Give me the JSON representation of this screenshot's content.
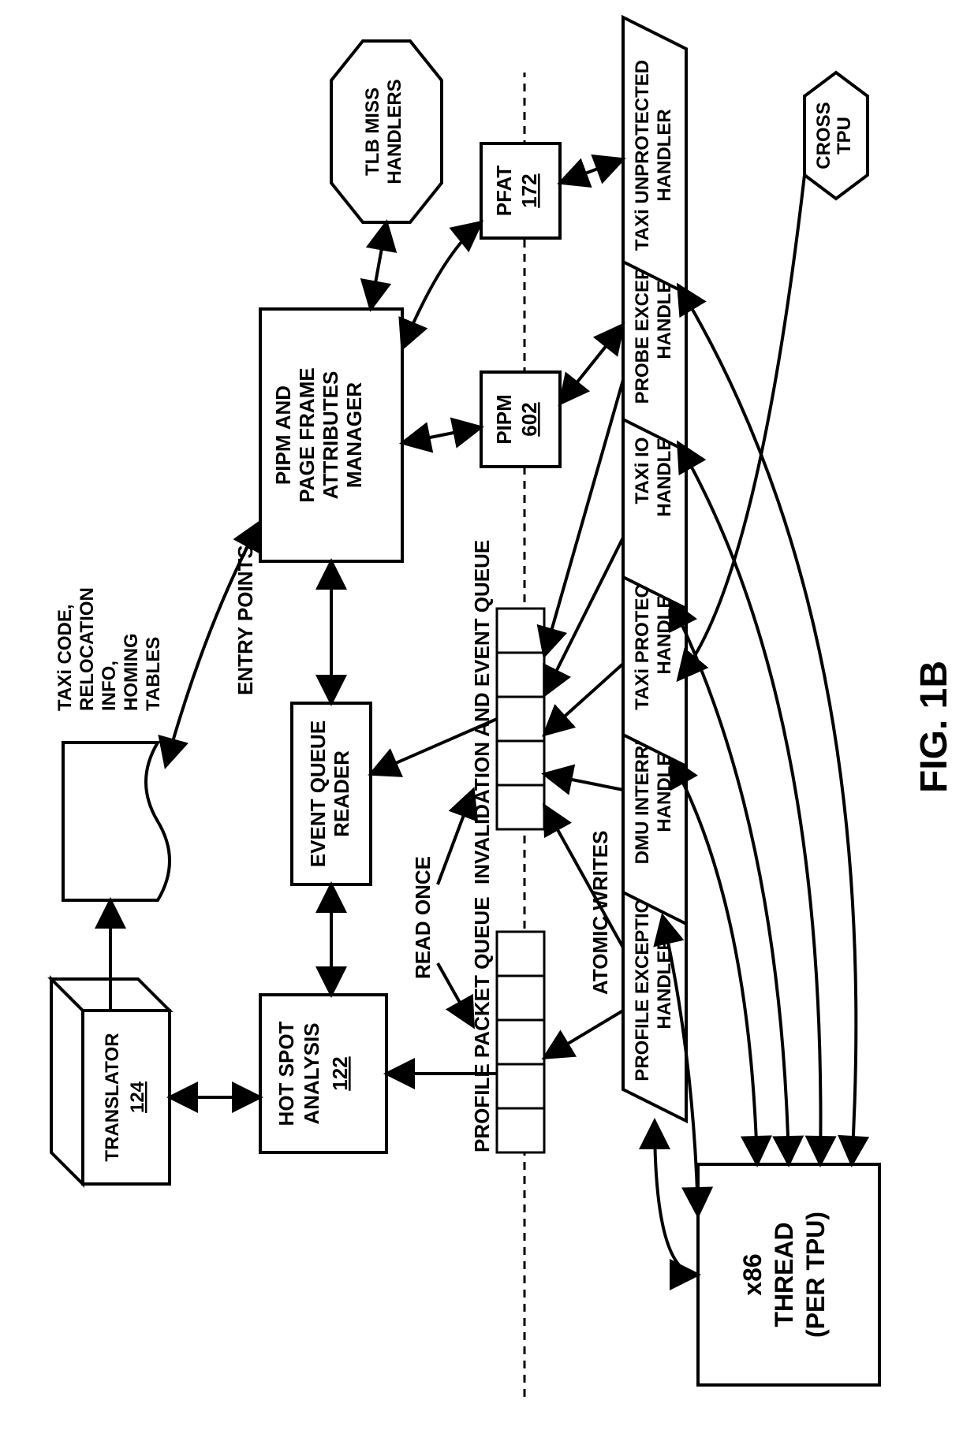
{
  "figure_label": "FIG. 1B",
  "blocks": {
    "x86_thread": {
      "line1": "x86",
      "line2": "THREAD",
      "line3": "(PER TPU)"
    },
    "cross_tpu": {
      "line1": "CROSS",
      "line2": "TPU"
    },
    "profile_exc": {
      "line1": "PROFILE EXCEPTION",
      "line2": "HANDLER"
    },
    "dmu_int": {
      "line1": "DMU INTERRUPT",
      "line2": "HANDLER"
    },
    "taxi_prot": {
      "line1": "TAXi PROTECTED",
      "line2": "HANDLER"
    },
    "taxi_io": {
      "line1": "TAXi IO",
      "line2": "HANDLER"
    },
    "probe_exc": {
      "line1": "PROBE EXCEPTION",
      "line2": "HANDLER"
    },
    "taxi_unprot": {
      "line1": "TAXi UNPROTECTED",
      "line2": "HANDLER"
    },
    "hot_spot": {
      "line1": "HOT SPOT",
      "line2": "ANALYSIS",
      "ref": "122"
    },
    "translator": {
      "line1": "TRANSLATOR",
      "ref": "124"
    },
    "event_reader": {
      "line1": "EVENT QUEUE",
      "line2": "READER"
    },
    "pipm_mgr": {
      "line1": "PIPM AND",
      "line2": "PAGE FRAME",
      "line3": "ATTRIBUTES",
      "line4": "MANAGER"
    },
    "pipm": {
      "line1": "PIPM",
      "ref": "602"
    },
    "pfat": {
      "line1": "PFAT",
      "ref": "172"
    },
    "tlb": {
      "line1": "TLB MISS",
      "line2": "HANDLERS"
    },
    "output": {
      "line1": "TAXi CODE,",
      "line2": "RELOCATION",
      "line3": "INFO,",
      "line4": "HOMING",
      "line5": "TABLES"
    }
  },
  "labels": {
    "ppq": "PROFILE PACKET QUEUE",
    "ieq": "INVALIDATION AND EVENT QUEUE",
    "atomic": "ATOMIC WRITES",
    "read_once": "READ ONCE",
    "entry_points": "ENTRY POINTS"
  },
  "chart_data": {
    "type": "diagram",
    "title": "FIG. 1B",
    "nodes": [
      {
        "id": "x86_thread",
        "label": "x86 THREAD (PER TPU)",
        "shape": "rect"
      },
      {
        "id": "cross_tpu",
        "label": "CROSS TPU",
        "shape": "hexagon"
      },
      {
        "id": "profile_exc",
        "label": "PROFILE EXCEPTION HANDLER",
        "shape": "parallelogram"
      },
      {
        "id": "dmu_int",
        "label": "DMU INTERRUPT HANDLER",
        "shape": "parallelogram"
      },
      {
        "id": "taxi_prot",
        "label": "TAXi PROTECTED HANDLER",
        "shape": "parallelogram"
      },
      {
        "id": "taxi_io",
        "label": "TAXi IO HANDLER",
        "shape": "parallelogram"
      },
      {
        "id": "probe_exc",
        "label": "PROBE EXCEPTION HANDLER",
        "shape": "parallelogram"
      },
      {
        "id": "taxi_unprot",
        "label": "TAXi UNPROTECTED HANDLER",
        "shape": "parallelogram"
      },
      {
        "id": "ppq",
        "label": "PROFILE PACKET QUEUE",
        "shape": "queue"
      },
      {
        "id": "ieq",
        "label": "INVALIDATION AND EVENT QUEUE",
        "shape": "queue"
      },
      {
        "id": "hot_spot",
        "label": "HOT SPOT ANALYSIS",
        "ref": "122",
        "shape": "rect"
      },
      {
        "id": "translator",
        "label": "TRANSLATOR",
        "ref": "124",
        "shape": "cube"
      },
      {
        "id": "event_reader",
        "label": "EVENT QUEUE READER",
        "shape": "rect"
      },
      {
        "id": "pipm_mgr",
        "label": "PIPM AND PAGE FRAME ATTRIBUTES MANAGER",
        "shape": "rect"
      },
      {
        "id": "pipm",
        "label": "PIPM",
        "ref": "602",
        "shape": "rect"
      },
      {
        "id": "pfat",
        "label": "PFAT",
        "ref": "172",
        "shape": "rect"
      },
      {
        "id": "tlb",
        "label": "TLB MISS HANDLERS",
        "shape": "octagon"
      },
      {
        "id": "output",
        "label": "TAXi CODE, RELOCATION INFO, HOMING TABLES",
        "shape": "document"
      }
    ],
    "edges": [
      {
        "from": "x86_thread",
        "to": "profile_exc",
        "dir": "bi"
      },
      {
        "from": "x86_thread",
        "to": "dmu_int",
        "dir": "bi"
      },
      {
        "from": "x86_thread",
        "to": "taxi_prot",
        "dir": "bi"
      },
      {
        "from": "x86_thread",
        "to": "taxi_io",
        "dir": "bi"
      },
      {
        "from": "x86_thread",
        "to": "probe_exc",
        "dir": "bi"
      },
      {
        "from": "x86_thread",
        "to": "taxi_unprot",
        "dir": "bi"
      },
      {
        "from": "cross_tpu",
        "to": "dmu_int",
        "dir": "uni"
      },
      {
        "from": "profile_exc",
        "to": "ppq",
        "dir": "uni",
        "label": "ATOMIC WRITES"
      },
      {
        "from": "profile_exc",
        "to": "ieq",
        "dir": "uni",
        "label": "ATOMIC WRITES"
      },
      {
        "from": "dmu_int",
        "to": "ieq",
        "dir": "uni"
      },
      {
        "from": "taxi_prot",
        "to": "ieq",
        "dir": "uni"
      },
      {
        "from": "taxi_io",
        "to": "ieq",
        "dir": "uni"
      },
      {
        "from": "probe_exc",
        "to": "ieq",
        "dir": "uni"
      },
      {
        "from": "ppq",
        "to": "hot_spot",
        "dir": "uni",
        "label": "READ ONCE"
      },
      {
        "from": "ieq",
        "to": "event_reader",
        "dir": "uni",
        "label": "READ ONCE"
      },
      {
        "from": "hot_spot",
        "to": "translator",
        "dir": "bi"
      },
      {
        "from": "hot_spot",
        "to": "event_reader",
        "dir": "bi"
      },
      {
        "from": "translator",
        "to": "output",
        "dir": "uni"
      },
      {
        "from": "event_reader",
        "to": "pipm_mgr",
        "dir": "bi"
      },
      {
        "from": "output",
        "to": "pipm_mgr",
        "dir": "bi",
        "label": "ENTRY POINTS"
      },
      {
        "from": "pipm_mgr",
        "to": "pipm",
        "dir": "bi"
      },
      {
        "from": "pipm_mgr",
        "to": "pfat",
        "dir": "bi"
      },
      {
        "from": "pipm_mgr",
        "to": "tlb",
        "dir": "bi"
      },
      {
        "from": "taxi_unprot",
        "to": "pfat",
        "dir": "bi"
      },
      {
        "from": "probe_exc",
        "to": "pipm",
        "dir": "bi"
      }
    ]
  }
}
